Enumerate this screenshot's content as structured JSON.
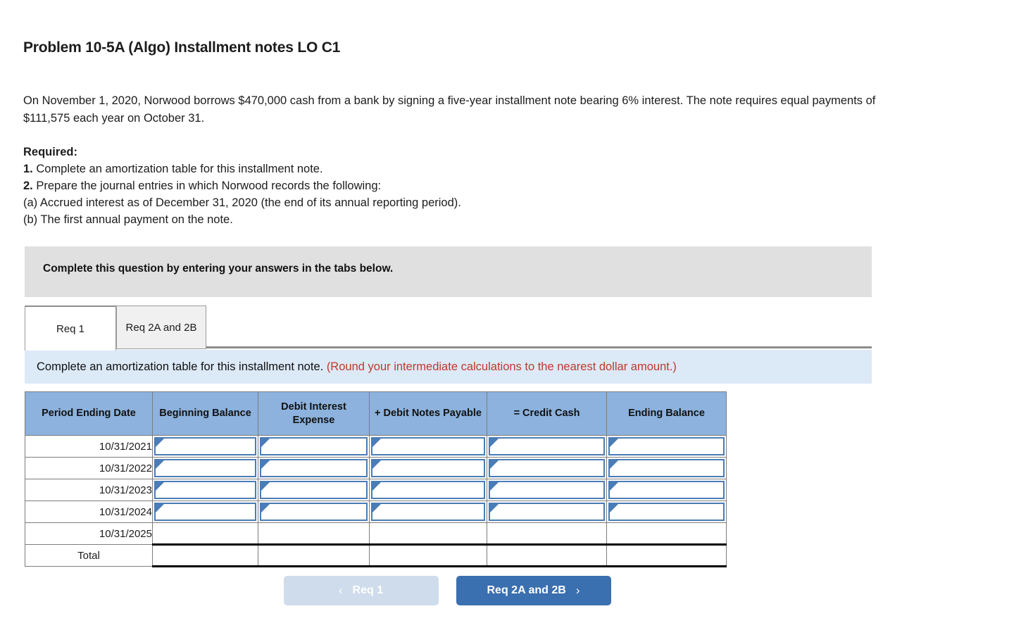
{
  "problem": {
    "title": "Problem 10-5A (Algo) Installment notes LO C1",
    "intro": "On November 1, 2020, Norwood borrows $470,000 cash from a bank by signing a five-year installment note bearing 6% interest. The note requires equal payments of $111,575 each year on October 31.",
    "required_heading": "Required:",
    "required_items": [
      {
        "num": "1.",
        "text": " Complete an amortization table for this installment note."
      },
      {
        "num": "2.",
        "text": " Prepare the journal entries in which Norwood records the following:"
      },
      {
        "num": "",
        "text": "(a) Accrued interest as of December 31, 2020 (the end of its annual reporting period)."
      },
      {
        "num": "",
        "text": "(b) The first annual payment on the note."
      }
    ]
  },
  "banner": {
    "text": "Complete this question by entering your answers in the tabs below."
  },
  "tabs": [
    {
      "label": "Req 1",
      "active": true
    },
    {
      "label": "Req 2A and 2B",
      "active": false
    }
  ],
  "infobar": {
    "instruction": "Complete an amortization table for this installment note.",
    "note": "(Round your intermediate calculations to the nearest dollar amount.)"
  },
  "table": {
    "headers": [
      "Period Ending Date",
      "Beginning Balance",
      "Debit Interest Expense",
      "+ Debit Notes Payable",
      "= Credit Cash",
      "Ending Balance"
    ],
    "rows": [
      {
        "label": "10/31/2021",
        "inputs": true,
        "values": [
          "",
          "",
          "",
          "",
          ""
        ]
      },
      {
        "label": "10/31/2022",
        "inputs": true,
        "values": [
          "",
          "",
          "",
          "",
          ""
        ]
      },
      {
        "label": "10/31/2023",
        "inputs": true,
        "values": [
          "",
          "",
          "",
          "",
          ""
        ]
      },
      {
        "label": "10/31/2024",
        "inputs": true,
        "values": [
          "",
          "",
          "",
          "",
          ""
        ]
      },
      {
        "label": "10/31/2025",
        "inputs": false,
        "values": [
          "",
          "",
          "",
          "",
          ""
        ]
      },
      {
        "label": "Total",
        "inputs": false,
        "values": [
          "",
          "",
          "",
          "",
          ""
        ]
      }
    ]
  },
  "footer": {
    "prev_label": "Req 1",
    "prev_chevron": "‹",
    "next_label": "Req 2A and 2B",
    "next_chevron": "›"
  },
  "colors": {
    "header_blue": "#8cb2dd",
    "input_border": "#4a7cb5",
    "info_blue": "#dce9f7",
    "banner_grey": "#e0e0e0",
    "note_red": "#c0392b",
    "button_blue": "#3a6fb0",
    "button_disabled": "#cfdcec"
  }
}
